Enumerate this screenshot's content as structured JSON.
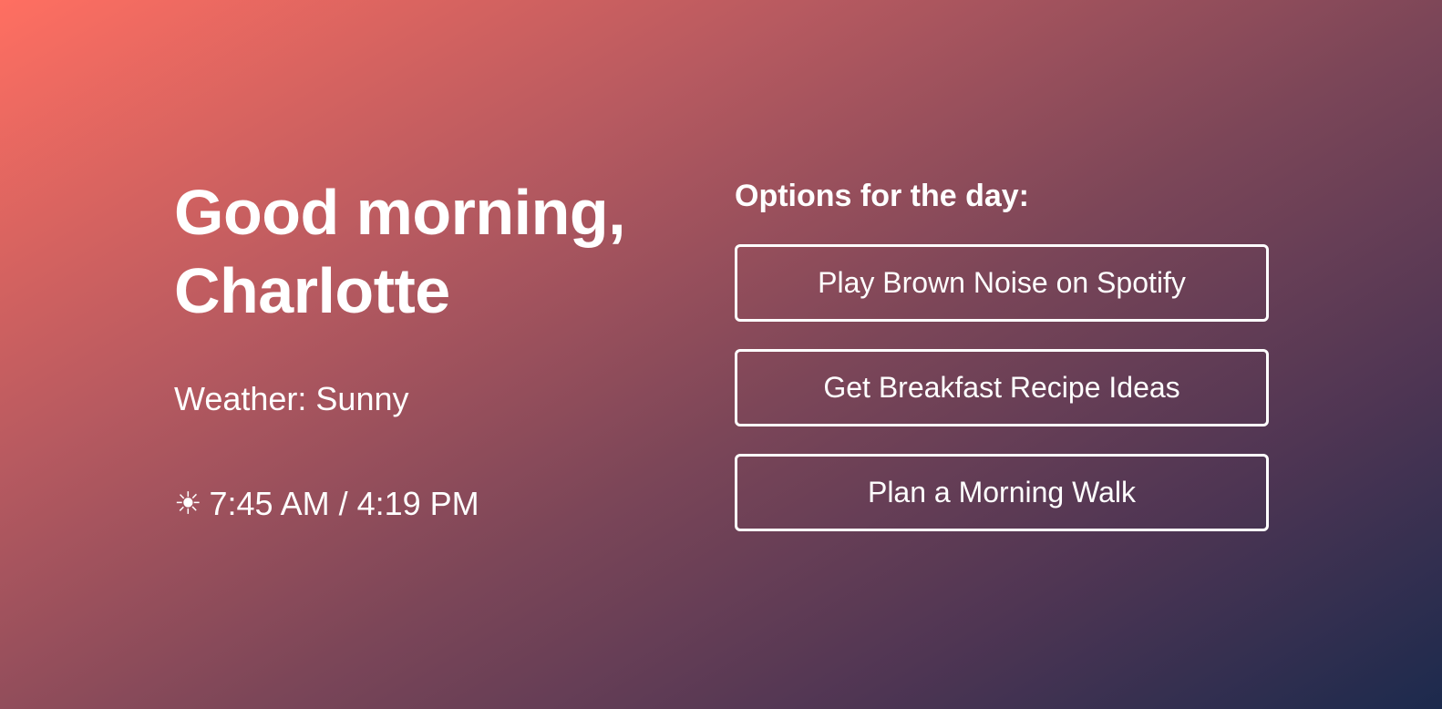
{
  "greeting": {
    "line1": "Good morning,",
    "line2": "Charlotte"
  },
  "weather": {
    "text": "Weather: Sunny"
  },
  "sun": {
    "icon": "sun-icon",
    "glyph": "☀",
    "times": "7:45 AM / 4:19 PM"
  },
  "options": {
    "title": "Options for the day:",
    "items": [
      {
        "label": "Play Brown Noise on Spotify"
      },
      {
        "label": "Get Breakfast Recipe Ideas"
      },
      {
        "label": "Plan a Morning Walk"
      }
    ]
  },
  "colors": {
    "gradient_start": "#ff6f61",
    "gradient_end": "#1c2a4d",
    "text": "#ffffff"
  }
}
